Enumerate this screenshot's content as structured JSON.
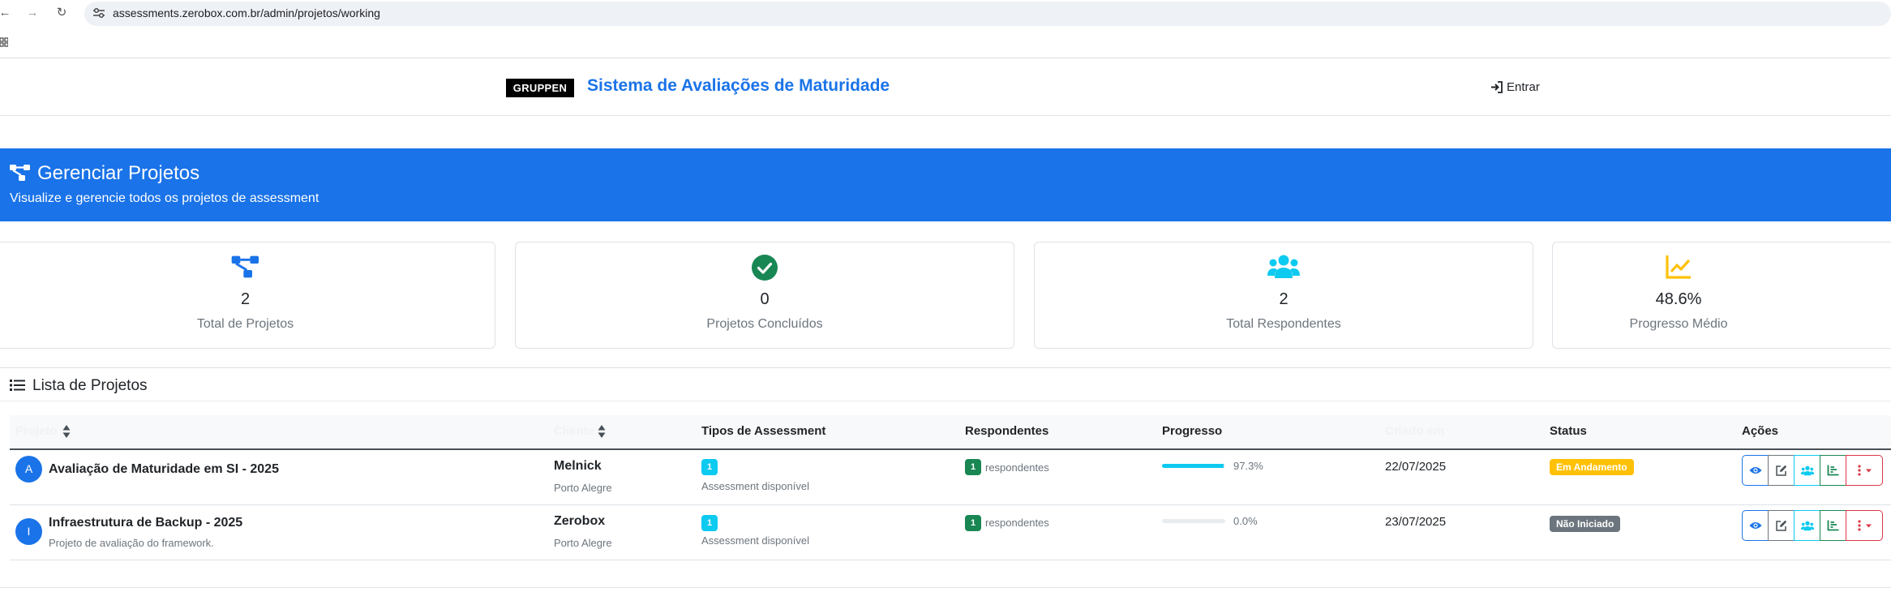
{
  "browser": {
    "url": "assessments.zerobox.com.br/admin/projetos/working"
  },
  "header": {
    "logo_text": "GRUPPEN",
    "title": "Sistema de Avaliações de Maturidade",
    "login_label": "Entrar"
  },
  "hero": {
    "title": "Gerenciar Projetos",
    "subtitle": "Visualize e gerencie todos os projetos de assessment"
  },
  "stats": [
    {
      "icon": "project-diagram-icon",
      "value": "2",
      "label": "Total de Projetos",
      "color": "#1a73e8"
    },
    {
      "icon": "check-circle-icon",
      "value": "0",
      "label": "Projetos Concluídos",
      "color": "#198754"
    },
    {
      "icon": "users-icon",
      "value": "2",
      "label": "Total Respondentes",
      "color": "#0dcaf0"
    },
    {
      "icon": "chart-line-icon",
      "value": "48.6%",
      "label": "Progresso Médio",
      "color": "#ffc107"
    }
  ],
  "list": {
    "title": "Lista de Projetos",
    "columns": {
      "project": "Projeto",
      "client": "Cliente",
      "types": "Tipos de Assessment",
      "respondents": "Respondentes",
      "progress": "Progresso",
      "created": "Criado em",
      "status": "Status",
      "actions": "Ações"
    },
    "rows": [
      {
        "avatar": "A",
        "name": "Avaliação de Maturidade em SI - 2025",
        "description": "",
        "client": "Melnick",
        "city": "Porto Alegre",
        "types_count": "1",
        "types_text": "Assessment disponível",
        "respondents_count": "1",
        "respondents_text": "respondentes",
        "progress": 97.3,
        "progress_text": "97.3%",
        "date": "22/07/2025",
        "status": "Em Andamento",
        "status_color": "#ffc107"
      },
      {
        "avatar": "I",
        "name": "Infraestrutura de Backup - 2025",
        "description": "Projeto de avaliação do framework.",
        "client": "Zerobox",
        "city": "Porto Alegre",
        "types_count": "1",
        "types_text": "Assessment disponível",
        "respondents_count": "1",
        "respondents_text": "respondentes",
        "progress": 0.0,
        "progress_text": "0.0%",
        "date": "23/07/2025",
        "status": "Não Iniciado",
        "status_color": "#6c757d"
      }
    ],
    "action_icons": [
      "eye-icon",
      "edit-icon",
      "users-icon",
      "chart-icon",
      "more-icon"
    ]
  }
}
